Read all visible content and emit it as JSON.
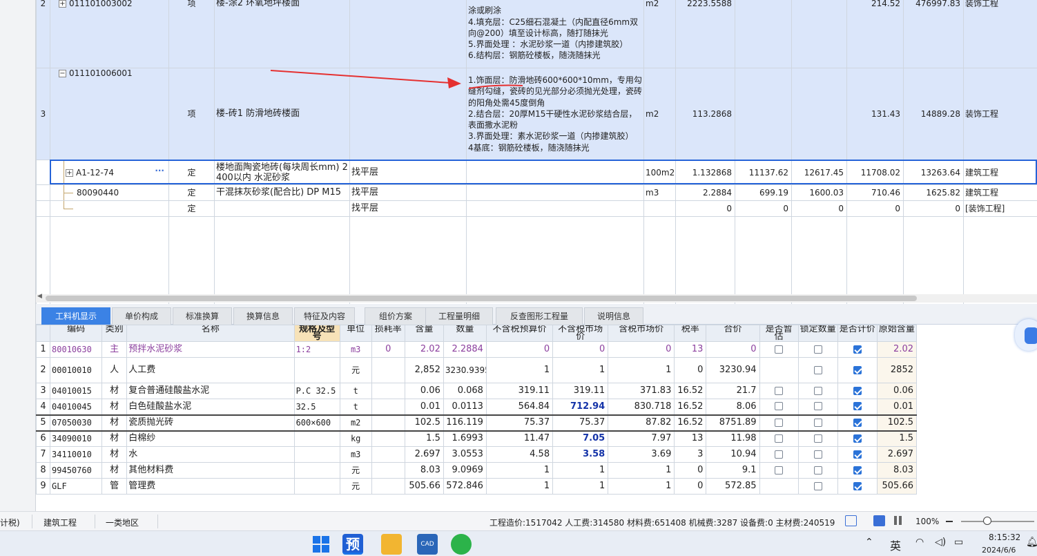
{
  "top_rows": [
    {
      "n": "2",
      "code": "011101003002",
      "type": "项",
      "name": "楼-涂2 环氧地坪楼面",
      "desc": "涂或刷涂\n4.填充层：C25细石混凝土（内配直径6mm双向@200）填至设计标高，随打随抹光\n5.界面处理 ：水泥砂浆一道（内掺建筑胶）\n6.结构层：钢筋砼楼板，随浇随抹光",
      "unit": "m2",
      "qty": "2223.5588",
      "v1": "",
      "v2": "",
      "v3": "214.52",
      "v4": "476997.83",
      "prof": "装饰工程"
    },
    {
      "n": "3",
      "code": "011101006001",
      "type": "项",
      "name": "楼-砖1 防滑地砖楼面",
      "desc": "1.饰面层：防滑地砖600*600*10mm，专用勾缝剂勾缝，瓷砖的见光部分必须抛光处理，瓷砖的阳角处需45度倒角\n2.结合层：20厚M15干硬性水泥砂浆结合层，表面撒水泥粉\n3.界面处理：素水泥砂浆一道（内掺建筑胶）\n4基底：钢筋砼楼板，随浇随抹光",
      "unit": "m2",
      "qty": "113.2868",
      "v1": "",
      "v2": "",
      "v3": "131.43",
      "v4": "14889.28",
      "prof": "装饰工程"
    },
    {
      "n": "",
      "code": "A1-12-74",
      "dots": "···",
      "type": "定",
      "name": "楼地面陶瓷地砖(每块周长mm) 2400以内 水泥砂浆",
      "spec": "找平层",
      "unit": "100m2",
      "qty": "1.132868",
      "v1": "11137.62",
      "v2": "12617.45",
      "v3": "11708.02",
      "v4": "13263.64",
      "prof": "建筑工程"
    },
    {
      "n": "",
      "code": "80090440",
      "type": "定",
      "name": "干混抹灰砂浆(配合比) DP M15",
      "spec": "找平层",
      "unit": "m3",
      "qty": "2.2884",
      "v1": "699.19",
      "v2": "1600.03",
      "v3": "710.46",
      "v4": "1625.82",
      "prof": "建筑工程"
    },
    {
      "n": "",
      "code": "",
      "type": "定",
      "name": "",
      "spec": "找平层",
      "unit": "",
      "qty": "0",
      "v1": "0",
      "v2": "0",
      "v3": "0",
      "v4": "0",
      "prof": "[装饰工程]"
    }
  ],
  "tabs": [
    "工料机显示",
    "单价构成",
    "标准换算",
    "换算信息",
    "特征及内容",
    "组价方案",
    "工程量明细",
    "反查图形工程量",
    "说明信息"
  ],
  "headers": [
    "编码",
    "类别",
    "名称",
    "规格及型号",
    "单位",
    "损耗率",
    "含量",
    "数量",
    "不含税预算价",
    "不含税市场价",
    "含税市场价",
    "税率",
    "合价",
    "是否暂估",
    "锁定数量",
    "是否计价",
    "原始含量"
  ],
  "rows": [
    {
      "n": "1",
      "code": "80010630",
      "cat": "主",
      "name": "预拌水泥砂浆",
      "spec": "1:2",
      "unit": "m3",
      "loss": "0",
      "content": "2.02",
      "qty": "2.2884",
      "p1": "0",
      "p2": "0",
      "p3": "0",
      "tax": "13",
      "total": "0",
      "zg": false,
      "sd": false,
      "jj": true,
      "orig": "2.02",
      "purple": true
    },
    {
      "n": "2",
      "code": "00010010",
      "cat": "人",
      "name": "人工费",
      "spec": "",
      "unit": "元",
      "loss": "",
      "content": "2,852",
      "qty": "3230.9395",
      "p1": "1",
      "p2": "1",
      "p3": "1",
      "tax": "0",
      "total": "3230.94",
      "zg": null,
      "sd": false,
      "jj": true,
      "orig": "2852"
    },
    {
      "n": "3",
      "code": "04010015",
      "cat": "材",
      "name": "复合普通硅酸盐水泥",
      "spec": "P.C 32.5",
      "unit": "t",
      "loss": "",
      "content": "0.06",
      "qty": "0.068",
      "p1": "319.11",
      "p2": "319.11",
      "p3": "371.83",
      "tax": "16.52",
      "total": "21.7",
      "zg": false,
      "sd": false,
      "jj": true,
      "orig": "0.06"
    },
    {
      "n": "4",
      "code": "04010045",
      "cat": "材",
      "name": "白色硅酸盐水泥",
      "spec": "32.5",
      "unit": "t",
      "loss": "",
      "content": "0.01",
      "qty": "0.0113",
      "p1": "564.84",
      "p2": "712.94",
      "p3": "830.718",
      "tax": "16.52",
      "total": "8.06",
      "zg": false,
      "sd": false,
      "jj": true,
      "orig": "0.01",
      "blue": true
    },
    {
      "n": "5",
      "code": "07050030",
      "cat": "材",
      "name": "瓷质抛光砖",
      "spec": "600×600",
      "unit": "m2",
      "loss": "",
      "content": "102.5",
      "qty": "116.119",
      "p1": "75.37",
      "p2": "75.37",
      "p3": "87.82",
      "tax": "16.52",
      "total": "8751.89",
      "zg": false,
      "sd": false,
      "jj": true,
      "orig": "102.5"
    },
    {
      "n": "6",
      "code": "34090010",
      "cat": "材",
      "name": "白棉纱",
      "spec": "",
      "unit": "kg",
      "loss": "",
      "content": "1.5",
      "qty": "1.6993",
      "p1": "11.47",
      "p2": "7.05",
      "p3": "7.97",
      "tax": "13",
      "total": "11.98",
      "zg": false,
      "sd": false,
      "jj": true,
      "orig": "1.5",
      "blue": true
    },
    {
      "n": "7",
      "code": "34110010",
      "cat": "材",
      "name": "水",
      "spec": "",
      "unit": "m3",
      "loss": "",
      "content": "2.697",
      "qty": "3.0553",
      "p1": "4.58",
      "p2": "3.58",
      "p3": "3.69",
      "tax": "3",
      "total": "10.94",
      "zg": false,
      "sd": false,
      "jj": true,
      "orig": "2.697",
      "blue": true
    },
    {
      "n": "8",
      "code": "99450760",
      "cat": "材",
      "name": "其他材料费",
      "spec": "",
      "unit": "元",
      "loss": "",
      "content": "8.03",
      "qty": "9.0969",
      "p1": "1",
      "p2": "1",
      "p3": "1",
      "tax": "0",
      "total": "9.1",
      "zg": false,
      "sd": false,
      "jj": true,
      "orig": "8.03"
    },
    {
      "n": "9",
      "code": "GLF",
      "cat": "管",
      "name": "管理费",
      "spec": "",
      "unit": "元",
      "loss": "",
      "content": "505.66",
      "qty": "572.846",
      "p1": "1",
      "p2": "1",
      "p3": "1",
      "tax": "0",
      "total": "572.85",
      "zg": null,
      "sd": false,
      "jj": true,
      "orig": "505.66"
    }
  ],
  "status": {
    "left": "计税)",
    "prof": "建筑工程",
    "region": "一类地区",
    "summary": "工程造价:1517042  人工费:314580  材料费:651408  机械费:3287  设备费:0  主材费:240519",
    "zoom": "100%"
  },
  "taskbar": {
    "app_glyph": "预",
    "cad_label": "CAD",
    "ime": "英",
    "time": "8:15:32",
    "date": "2024/6/6"
  }
}
